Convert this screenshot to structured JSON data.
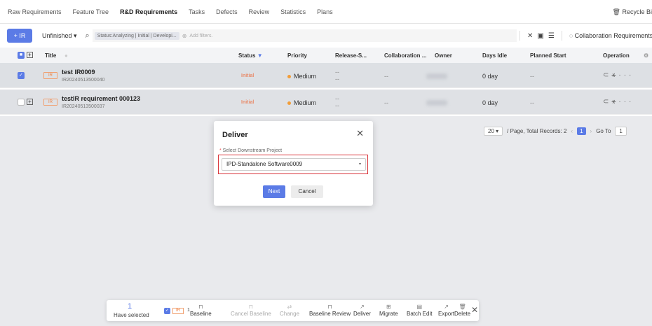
{
  "tabs": [
    "Raw Requirements",
    "Feature Tree",
    "R&D Requirements",
    "Tasks",
    "Defects",
    "Review",
    "Statistics",
    "Plans"
  ],
  "recycle_bin": "Recycle Bi",
  "toolbar": {
    "add_label": "+ IR",
    "view_label": "Unfinished ▾",
    "filter_chip": "Status:Analyzing | Initial | Developi...",
    "filter_placeholder": "Add filters.",
    "collab_label": "Collaboration Requirements"
  },
  "table": {
    "columns": [
      "Title",
      "Status",
      "Priority",
      "Release-S...",
      "Collaboration ...",
      "Owner",
      "Days Idle",
      "Planned Start",
      "Operation"
    ],
    "rows": [
      {
        "tag": "IR",
        "title": "test IR0009",
        "id": "IR20240513500040",
        "status": "Initial",
        "priority": "Medium",
        "release": "--",
        "release2": "--",
        "collab": "--",
        "days_idle": "0 day",
        "planned_start": "--",
        "selected": true
      },
      {
        "tag": "IR",
        "title": "testIR requirement 000123",
        "id": "IR20240513500037",
        "status": "Initial",
        "priority": "Medium",
        "release": "--",
        "release2": "--",
        "collab": "--",
        "days_idle": "0 day",
        "planned_start": "--",
        "selected": false
      }
    ]
  },
  "pager": {
    "page_size": "20",
    "summary": "/ Page,  Total Records: 2",
    "current": "1",
    "goto_label": "Go To",
    "goto_value": "1"
  },
  "modal": {
    "title": "Deliver",
    "label": "Select Downstream Project",
    "selected_value": "IPD-Standalone Software0009",
    "next_label": "Next",
    "cancel_label": "Cancel"
  },
  "actionbar": {
    "count": "1",
    "have_selected": "Have selected",
    "ir_tag": "IR",
    "ir_count": "1",
    "actions": [
      {
        "label": "Baseline",
        "enabled": true
      },
      {
        "label": "Cancel Baseline",
        "enabled": false
      },
      {
        "label": "Change",
        "enabled": false
      },
      {
        "label": "Baseline Review",
        "enabled": true
      },
      {
        "label": "Deliver",
        "enabled": true
      },
      {
        "label": "Migrate",
        "enabled": true
      },
      {
        "label": "Batch Edit",
        "enabled": true
      },
      {
        "label": "Export",
        "enabled": true
      },
      {
        "label": "Delete",
        "enabled": true
      }
    ]
  },
  "colors": {
    "accent": "#5b7be6",
    "status_initial": "#e88b6a",
    "priority_medium": "#f29d38",
    "highlight_border": "#d9343a"
  }
}
